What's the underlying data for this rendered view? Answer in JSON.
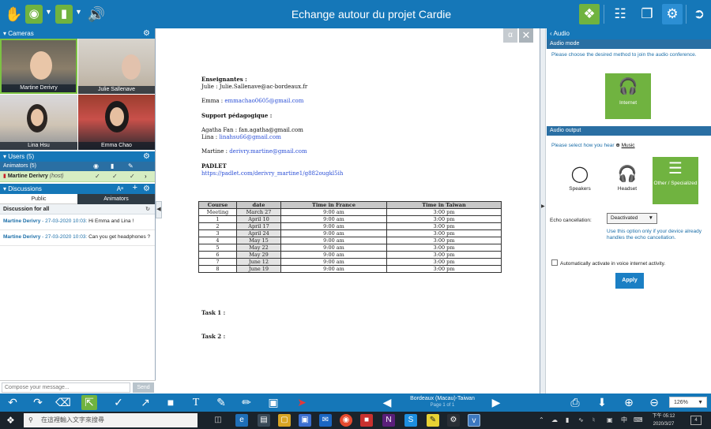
{
  "topbar": {
    "title": "Echange autour du projet Cardie"
  },
  "cameras": {
    "header": "Cameras",
    "tiles": [
      {
        "name": "Martine Derivry"
      },
      {
        "name": "Julie Sallenave"
      },
      {
        "name": "Lina Hsu"
      },
      {
        "name": "Emma Chao"
      }
    ]
  },
  "users": {
    "header": "Users (5)",
    "animators_label": "Animators (5)",
    "row": {
      "name": "Martine Derivry",
      "role": "(host)"
    }
  },
  "discussions": {
    "header": "Discussions",
    "font_label": "Aᵃ",
    "tabs": [
      "Public",
      "Animators"
    ],
    "for_label": "Discussion for all",
    "messages": [
      {
        "author": "Martine Derivry",
        "date": "- 27-03-2020 10:03:",
        "text": "Hi Emma and Lina !"
      },
      {
        "author": "Martine Derivry",
        "date": "- 27-03-2020 10:03:",
        "text": "Can you get headphones ?"
      }
    ],
    "compose_placeholder": "Compose your message...",
    "send_label": "Send"
  },
  "document": {
    "enseignantes_title": "Enseignantes :",
    "julie": "Julie : Julie.Sallenave@ac-bordeaux.fr",
    "emma_label": "Emma : ",
    "emma_email": "emmachao0605@gmail.com",
    "support_title": "Support pédagogique :",
    "agatha": "Agatha Fan : fan.agatha@gmail.com",
    "lina_label": "Lina : ",
    "lina_email": "linahsu66@gmail.com",
    "martine_label": "Martine : ",
    "martine_email": "derivry.martine@gmail.com",
    "padlet_title": "PADLET",
    "padlet_url": "https://padlet.com/derivry_martine1/g882ougkl5ih",
    "table": {
      "headers": [
        "Course",
        "date",
        "Time in France",
        "Time in Taiwan"
      ],
      "rows": [
        [
          "Meeting",
          "March 27",
          "9:00 am",
          "3:00 pm"
        ],
        [
          "1",
          "April 10",
          "9:00 am",
          "3:00 pm"
        ],
        [
          "2",
          "April 17",
          "9:00 am",
          "3:00 pm"
        ],
        [
          "3",
          "April 24",
          "9:00 am",
          "3:00 pm"
        ],
        [
          "4",
          "May 15",
          "9:00 am",
          "3:00 pm"
        ],
        [
          "5",
          "May 22",
          "9:00 am",
          "3:00 pm"
        ],
        [
          "6",
          "May 29",
          "9:00 am",
          "3:00 pm"
        ],
        [
          "7",
          "June 12",
          "9:00 am",
          "3:00 pm"
        ],
        [
          "8",
          "June 19",
          "9:00 am",
          "3:00 pm"
        ]
      ]
    },
    "task1": "Task 1 :",
    "task2": "Task 2 :"
  },
  "audio": {
    "header": "‹ Audio",
    "mode_title": "Audio mode",
    "mode_text": "Please choose the desired method to join the audio conference.",
    "internet_label": "Internet",
    "output_title": "Audio output",
    "output_text": "Please select how you hear",
    "music_label": "Music",
    "options": [
      "Speakers",
      "Headset",
      "Other / Specialized"
    ],
    "echo_label": "Echo cancellation:",
    "echo_value": "Deactivated",
    "echo_note": "Use this option only if your device already handles the echo cancellation.",
    "auto_label": "Automatically activate in voice internet activity.",
    "apply_label": "Apply"
  },
  "bottombar": {
    "page_title": "Bordeaux (Macau)-Taiwan",
    "page_sub": "Page 1 of 1",
    "zoom": "126%"
  },
  "taskbar": {
    "search_placeholder": "在這裡輸入文字來搜尋",
    "time": "下午 05:12",
    "date": "2020/3/27",
    "ime": "中",
    "notif_count": "4"
  },
  "colors": {
    "primary": "#1577b8",
    "accent_green": "#70b340",
    "link": "#2b4fd6"
  }
}
